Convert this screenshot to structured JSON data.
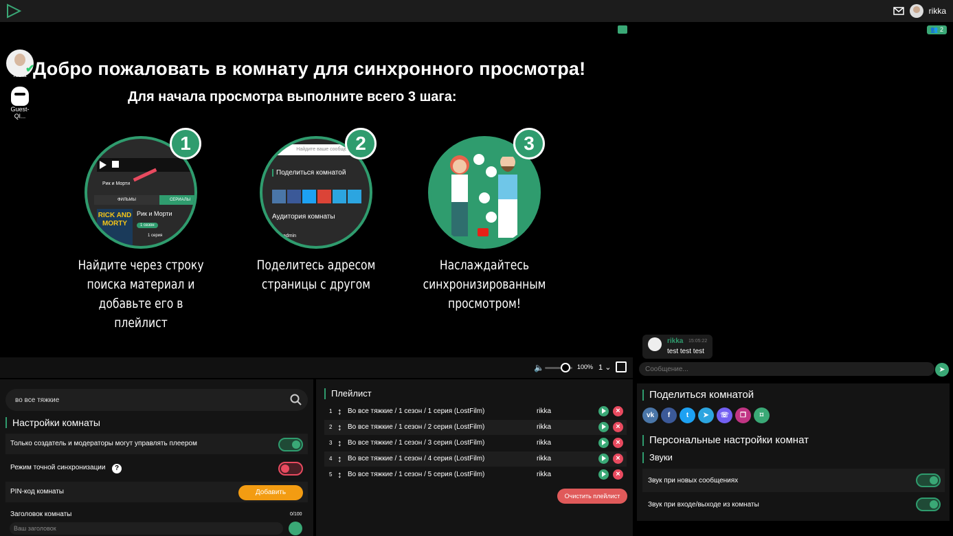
{
  "topbar": {
    "username": "rikka"
  },
  "viewers": [
    {
      "name": "rikka"
    },
    {
      "name": "Guest-Ql..."
    }
  ],
  "welcome": {
    "title": "Добро пожаловать в комнату для синхронного просмотра!",
    "subtitle": "Для начала просмотра выполните всего 3 шага:",
    "steps": [
      {
        "num": "1",
        "caption_l1": "Найдите через строку",
        "caption_l2": "поиска материал и",
        "caption_l3": "добавьте его в плейлист"
      },
      {
        "num": "2",
        "caption_l1": "Поделитесь адресом",
        "caption_l2": "страницы с другом",
        "caption_l3": ""
      },
      {
        "num": "3",
        "caption_l1": "Наслаждайтесь",
        "caption_l2": "синхронизированным",
        "caption_l3": "просмотром!"
      }
    ],
    "step1_img": {
      "card1": "Рик и Морти",
      "tab1": "ФИЛЬМЫ",
      "tab2": "СЕРИАЛЫ",
      "poster": "RICK AND MORTY",
      "title": "Рик и Морти",
      "season": "1 сезон",
      "episode": "1 серия"
    },
    "step2_img": {
      "search": "Найдите ваше сообщение",
      "share": "Поделиться комнатой",
      "audience": "Аудитория комнаты",
      "admin": "admin"
    }
  },
  "controls": {
    "volume_pct": "100%",
    "speed": "1",
    "volume_level": 0.75
  },
  "chat": {
    "viewer_count": "2",
    "messages": [
      {
        "user": "rikka",
        "time": "15:05:22",
        "text": "test test test"
      }
    ],
    "input_placeholder": "Сообщение..."
  },
  "search": {
    "value": "во все тяжкие"
  },
  "room_settings": {
    "heading": "Настройки комнаты",
    "control_label": "Только создатель и модераторы могут управлять плеером",
    "control_on": true,
    "sync_label": "Режим точной синхронизации",
    "sync_on": false,
    "pin_label": "PIN-код комнаты",
    "pin_button": "Добавить",
    "title_label": "Заголовок комнаты",
    "title_counter": "0/100",
    "title_placeholder": "Ваш заголовок"
  },
  "playlist": {
    "heading": "Плейлист",
    "items": [
      {
        "n": "1",
        "title": "Во все тяжкие / 1 сезон / 1 серия (LostFilm)",
        "user": "rikka"
      },
      {
        "n": "2",
        "title": "Во все тяжкие / 1 сезон / 2 серия (LostFilm)",
        "user": "rikka"
      },
      {
        "n": "3",
        "title": "Во все тяжкие / 1 сезон / 3 серия (LostFilm)",
        "user": "rikka"
      },
      {
        "n": "4",
        "title": "Во все тяжкие / 1 сезон / 4 серия (LostFilm)",
        "user": "rikka"
      },
      {
        "n": "5",
        "title": "Во все тяжкие / 1 сезон / 5 серия (LostFilm)",
        "user": "rikka"
      }
    ],
    "clear_button": "Очистить плейлист"
  },
  "share": {
    "heading": "Поделиться комнатой",
    "icons": [
      "vk-icon",
      "facebook-icon",
      "twitter-icon",
      "telegram-icon",
      "viber-icon",
      "copy-icon",
      "bookmark-icon"
    ],
    "colors": [
      "#4a76a8",
      "#3b5998",
      "#1da1f2",
      "#2ca5e0",
      "#7360f2",
      "#c13584",
      "#3aa876"
    ]
  },
  "personal": {
    "heading": "Персональные настройки комнат",
    "sounds_heading": "Звуки",
    "new_msg_label": "Звук при новых сообщениях",
    "join_leave_label": "Звук при входе/выходе из комнаты"
  },
  "colors": {
    "accent": "#3aa876",
    "danger": "#e84a5f",
    "orange": "#f39c12"
  }
}
